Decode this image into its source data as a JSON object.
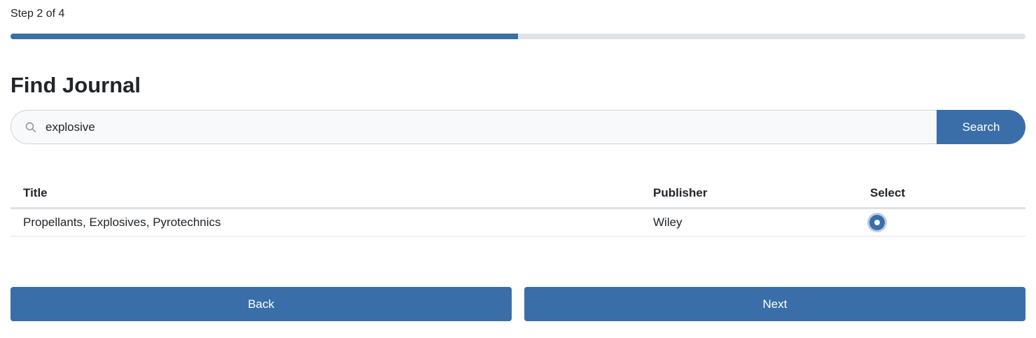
{
  "stepper": {
    "label": "Step 2 of 4",
    "current": 2,
    "total": 4,
    "progress_fraction": 0.5
  },
  "page": {
    "title": "Find Journal"
  },
  "search": {
    "icon": "search-icon",
    "value": "explosive",
    "button_label": "Search"
  },
  "results": {
    "columns": [
      "Title",
      "Publisher",
      "Select"
    ],
    "rows": [
      {
        "title": "Propellants, Explosives, Pyrotechnics",
        "publisher": "Wiley",
        "selected": true
      }
    ]
  },
  "nav": {
    "back_label": "Back",
    "next_label": "Next"
  },
  "colors": {
    "accent": "#3a6ea8",
    "track": "#e0e3ea"
  }
}
